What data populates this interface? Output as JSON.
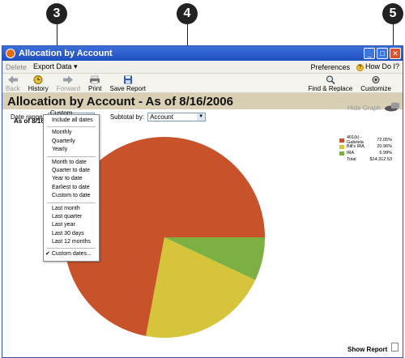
{
  "callouts": [
    "3",
    "4",
    "5"
  ],
  "window": {
    "title": "Allocation by Account"
  },
  "menu": {
    "left": [
      "Delete",
      "Export Data ▾"
    ],
    "preferences": "Preferences",
    "howdoi": "How Do I?"
  },
  "toolbar": {
    "back": "Back",
    "history": "History",
    "forward": "Forward",
    "print": "Print",
    "save_report": "Save Report",
    "find_replace": "Find & Replace",
    "customize": "Customize"
  },
  "report": {
    "heading": "Allocation by Account - As of 8/16/2006",
    "as_of": "As of 8/16,"
  },
  "controls": {
    "date_range_label": "Date range:",
    "date_range_value": "Custom dates",
    "subtotal_label": "Subtotal by:",
    "subtotal_value": "Account"
  },
  "date_options": {
    "g1": [
      "Include all dates"
    ],
    "g2": [
      "Monthly",
      "Quarterly",
      "Yearly"
    ],
    "g3": [
      "Month to date",
      "Quarter to date",
      "Year to date",
      "Earliest to date",
      "Custom to date"
    ],
    "g4": [
      "Last month",
      "Last quarter",
      "Last year",
      "Last 30 days",
      "Last 12 months"
    ],
    "g5": [
      "Custom dates..."
    ]
  },
  "graph": {
    "hide_label": "Hide Graph"
  },
  "legend": {
    "items": [
      {
        "name": "401(k) - Gabriela",
        "value": "72.05%",
        "color": "#c8532a"
      },
      {
        "name": "Bill's IRA",
        "value": "20.96%",
        "color": "#d6c43a"
      },
      {
        "name": "IRA",
        "value": "6.99%",
        "color": "#7cb043"
      }
    ],
    "total_label": "Total",
    "total_value": "$14,312.53"
  },
  "chart_data": {
    "type": "pie",
    "categories": [
      "401(k) - Gabriela",
      "Bill's IRA",
      "IRA"
    ],
    "values": [
      72.05,
      20.96,
      6.99
    ],
    "colors": [
      "#c8532a",
      "#d6c43a",
      "#7cb043"
    ]
  },
  "footer": {
    "show_report": "Show Report"
  }
}
